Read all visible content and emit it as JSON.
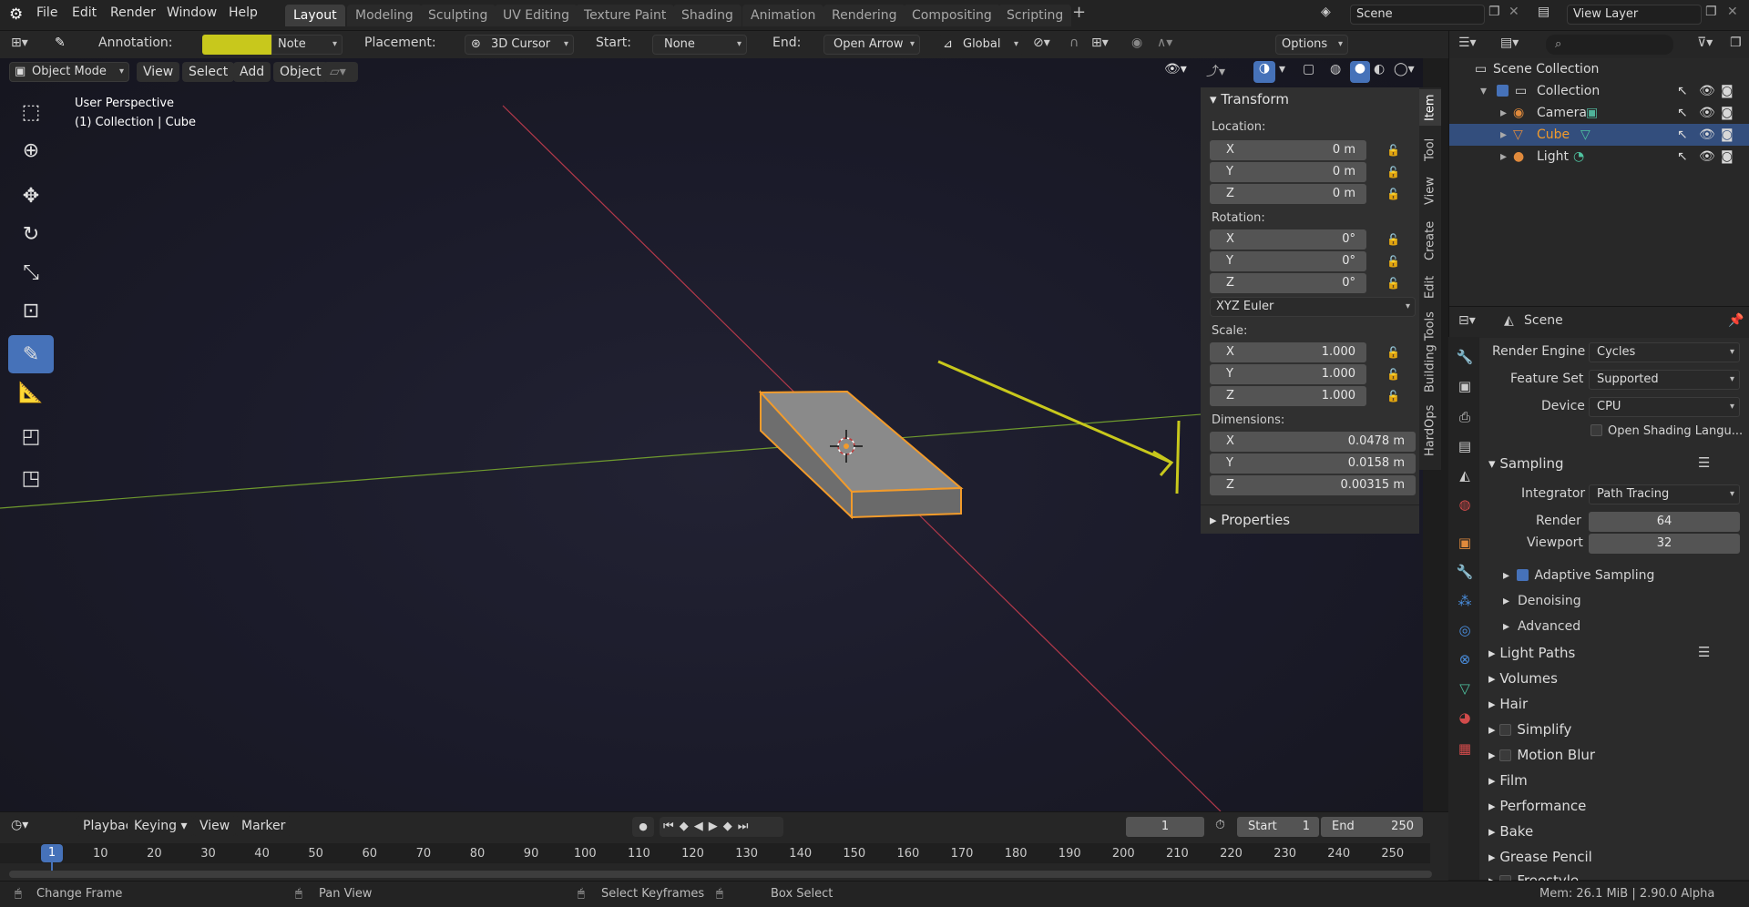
{
  "menu": {
    "items": [
      "File",
      "Edit",
      "Render",
      "Window",
      "Help"
    ]
  },
  "workspaces": [
    "Layout",
    "Modeling",
    "Sculpting",
    "UV Editing",
    "Texture Paint",
    "Shading",
    "Animation",
    "Rendering",
    "Compositing",
    "Scripting"
  ],
  "scene": {
    "name": "Scene",
    "view_layer": "View Layer"
  },
  "tool_header": {
    "annotation_label": "Annotation:",
    "annotation_color": "#c8c81c",
    "note": "Note",
    "placement_label": "Placement:",
    "placement": "3D Cursor",
    "start_label": "Start:",
    "start": "None",
    "end_label": "End:",
    "end": "Open Arrow",
    "orientation": "Global",
    "options": "Options"
  },
  "viewport_header": {
    "mode": "Object Mode",
    "view": "View",
    "select": "Select",
    "add": "Add",
    "object": "Object"
  },
  "viewport": {
    "perspective": "User Perspective",
    "collection_info": "(1) Collection | Cube"
  },
  "npanel": {
    "transform_title": "Transform",
    "location_label": "Location:",
    "location": [
      {
        "axis": "X",
        "value": "0 m"
      },
      {
        "axis": "Y",
        "value": "0 m"
      },
      {
        "axis": "Z",
        "value": "0 m"
      }
    ],
    "rotation_label": "Rotation:",
    "rotation": [
      {
        "axis": "X",
        "value": "0°"
      },
      {
        "axis": "Y",
        "value": "0°"
      },
      {
        "axis": "Z",
        "value": "0°"
      }
    ],
    "rotation_mode": "XYZ Euler",
    "scale_label": "Scale:",
    "scale": [
      {
        "axis": "X",
        "value": "1.000"
      },
      {
        "axis": "Y",
        "value": "1.000"
      },
      {
        "axis": "Z",
        "value": "1.000"
      }
    ],
    "dimensions_label": "Dimensions:",
    "dimensions": [
      {
        "axis": "X",
        "value": "0.0478 m"
      },
      {
        "axis": "Y",
        "value": "0.0158 m"
      },
      {
        "axis": "Z",
        "value": "0.00315 m"
      }
    ],
    "properties_title": "Properties",
    "tabs": [
      "Item",
      "Tool",
      "View",
      "Create",
      "Edit",
      "Building Tools",
      "HardOps"
    ]
  },
  "outliner": {
    "root": "Scene Collection",
    "collection": "Collection",
    "items": [
      "Camera",
      "Cube",
      "Light"
    ]
  },
  "properties": {
    "header": "Scene",
    "render_engine_label": "Render Engine",
    "render_engine": "Cycles",
    "feature_set_label": "Feature Set",
    "feature_set": "Supported",
    "device_label": "Device",
    "device": "CPU",
    "osl_label": "Open Shading Langu...",
    "sampling": "Sampling",
    "integrator_label": "Integrator",
    "integrator": "Path Tracing",
    "render_label": "Render",
    "render_samples": "64",
    "viewport_label": "Viewport",
    "viewport_samples": "32",
    "adaptive_sampling": "Adaptive Sampling",
    "denoising": "Denoising",
    "advanced": "Advanced",
    "sections": [
      "Light Paths",
      "Volumes",
      "Hair",
      "Simplify",
      "Motion Blur",
      "Film",
      "Performance",
      "Bake",
      "Grease Pencil",
      "Freestyle"
    ]
  },
  "timeline": {
    "playback": "Playback",
    "keying": "Keying",
    "view": "View",
    "marker": "Marker",
    "current_frame": "1",
    "start_label": "Start",
    "start": "1",
    "end_label": "End",
    "end": "250",
    "ticks": [
      "1",
      "10",
      "20",
      "30",
      "40",
      "50",
      "60",
      "70",
      "80",
      "90",
      "100",
      "110",
      "120",
      "130",
      "140",
      "150",
      "160",
      "170",
      "180",
      "190",
      "200",
      "210",
      "220",
      "230",
      "240",
      "250"
    ]
  },
  "statusbar": {
    "change_frame": "Change Frame",
    "pan_view": "Pan View",
    "select_keyframes": "Select Keyframes",
    "box_select": "Box Select",
    "memory": "Mem: 26.1 MiB | 2.90.0 Alpha"
  },
  "colors": {
    "selection_orange": "#f29b2b",
    "x_axis": "#b3394a",
    "y_axis": "#6f9a2e",
    "annotation": "#c8c81c",
    "active_blue": "#4672b9"
  }
}
